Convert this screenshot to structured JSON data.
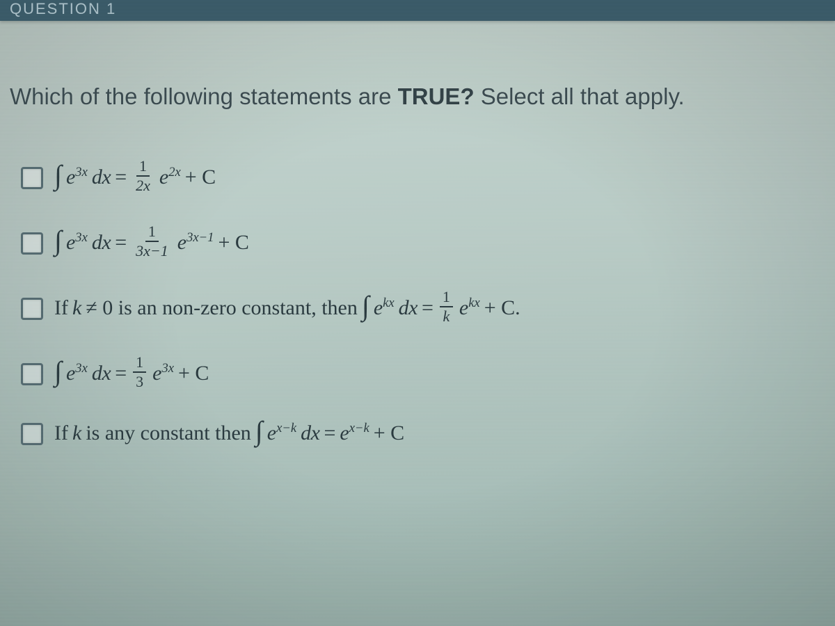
{
  "topstrip": {
    "text": "QUESTION 1"
  },
  "question": {
    "pre": "Which of the following statements are ",
    "bold": "TRUE?",
    "post": " Select all that apply."
  },
  "options": [
    {
      "int_base": "e",
      "int_exp": "3x",
      "diff": "dx",
      "eq": "=",
      "frac_num": "1",
      "frac_den": "2x",
      "rhs_base": "e",
      "rhs_exp": "2x",
      "plusC": "+ C"
    },
    {
      "int_base": "e",
      "int_exp": "3x",
      "diff": "dx",
      "eq": "=",
      "frac_num": "1",
      "frac_den": "3x−1",
      "rhs_base": "e",
      "rhs_exp": "3x−1",
      "plusC": "+ C"
    },
    {
      "pre": "If ",
      "k": "k",
      "neq": " ≠ 0 is an non-zero constant, then ",
      "int_base": "e",
      "int_exp": "kx",
      "diff": "dx",
      "eq": "=",
      "frac_num": "1",
      "frac_den": "k",
      "rhs_base": "e",
      "rhs_exp": "kx",
      "plusC": "+ C."
    },
    {
      "int_base": "e",
      "int_exp": "3x",
      "diff": "dx",
      "eq": "=",
      "frac_num": "1",
      "frac_den": "3",
      "rhs_base": "e",
      "rhs_exp": "3x",
      "plusC": "+ C"
    },
    {
      "pre": "If ",
      "k": "k",
      "txt": " is any constant then ",
      "int_base": "e",
      "int_exp": "x−k",
      "diff": "dx",
      "eq": "=",
      "rhs_base": "e",
      "rhs_exp": "x−k",
      "plusC": "+ C"
    }
  ]
}
